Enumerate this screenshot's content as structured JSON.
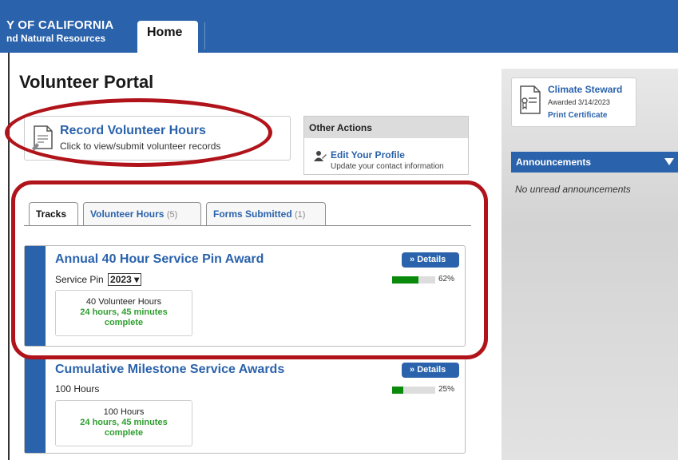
{
  "header": {
    "org_line1": "Y OF CALIFORNIA",
    "org_line2": "nd Natural Resources",
    "home_tab": "Home"
  },
  "page_title": "Volunteer Portal",
  "record_card": {
    "title": "Record Volunteer Hours",
    "subtitle": "Click to view/submit volunteer records",
    "icon": "document-edit-icon"
  },
  "other_actions": {
    "heading": "Other Actions",
    "edit_profile_label": "Edit Your Profile",
    "edit_profile_sub": "Update your contact information",
    "icon": "person-edit-icon"
  },
  "tabs": [
    {
      "label": "Tracks",
      "count": ""
    },
    {
      "label": "Volunteer Hours",
      "count": "(5)"
    },
    {
      "label": "Forms Submitted",
      "count": "(1)"
    }
  ],
  "tracks": [
    {
      "title": "Annual 40 Hour Service Pin Award",
      "sub_label": "Service Pin",
      "year": "2023",
      "box_line1": "40 Volunteer Hours",
      "box_line2": "24 hours, 45 minutes",
      "box_line3": "complete",
      "details": "Details",
      "progress": 0.62,
      "progress_label": "62%"
    },
    {
      "title": "Cumulative Milestone Service Awards",
      "sub_label": "100 Hours",
      "box_line1": "100 Hours",
      "box_line2": "24 hours, 45 minutes",
      "box_line3": "complete",
      "details": "Details",
      "progress": 0.25,
      "progress_label": "25%"
    }
  ],
  "sidebar": {
    "cert_title": "Climate Steward",
    "cert_date": "Awarded 3/14/2023",
    "cert_link": "Print Certificate",
    "announcements_heading": "Announcements",
    "announcements_empty": "No unread announcements"
  },
  "colors": {
    "brand_blue": "#2a62ab",
    "annotation_red": "#b0141a",
    "progress_green": "#0a8a0a"
  }
}
